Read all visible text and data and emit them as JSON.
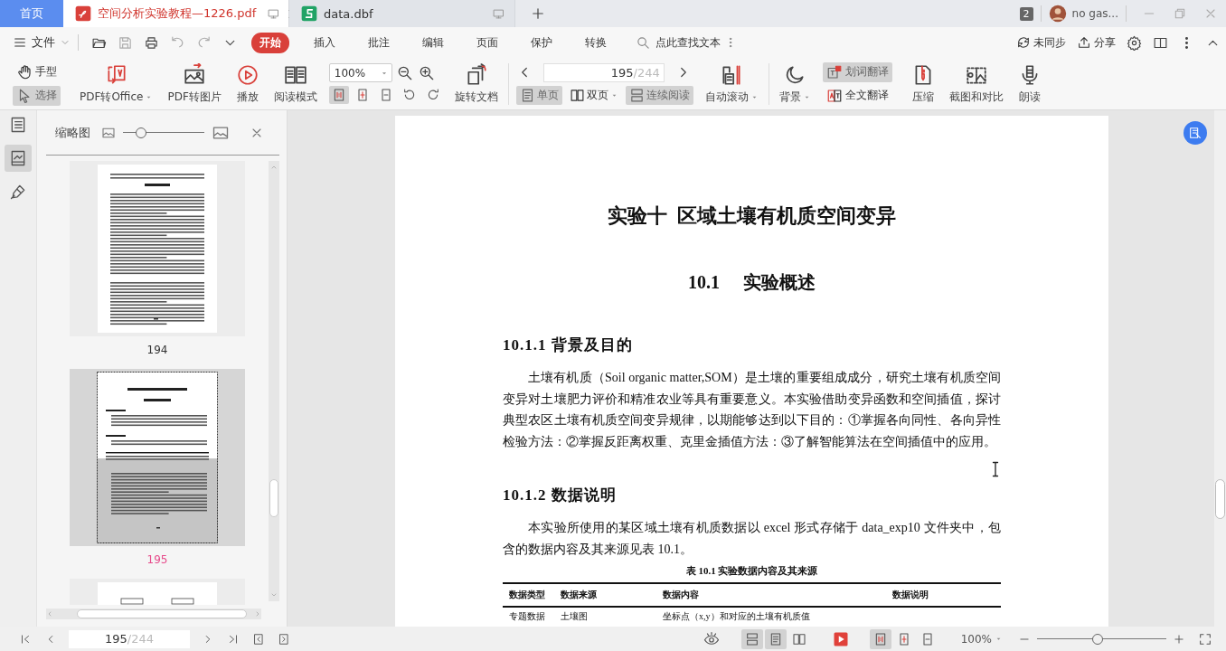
{
  "tabs": [
    {
      "label": "首页",
      "kind": "home",
      "selected": false
    },
    {
      "label": "空间分析实验教程—1226.pdf",
      "kind": "pdf",
      "selected": true
    },
    {
      "label": "data.dbf",
      "kind": "sheet",
      "selected": false
    }
  ],
  "window_count": "2",
  "user": {
    "name": "no gas..."
  },
  "menu": {
    "file": "文件",
    "items": [
      {
        "label": "开始",
        "selected": true
      },
      {
        "label": "插入",
        "selected": false
      },
      {
        "label": "批注",
        "selected": false
      },
      {
        "label": "编辑",
        "selected": false
      },
      {
        "label": "页面",
        "selected": false
      },
      {
        "label": "保护",
        "selected": false
      },
      {
        "label": "转换",
        "selected": false
      }
    ],
    "search": {
      "placeholder": "点此查找文本"
    },
    "sync": "未同步",
    "share": "分享"
  },
  "toolbar": {
    "groups": [
      [
        {
          "kind": "pair",
          "items": [
            {
              "label": "手型",
              "selected": false
            },
            {
              "label": "选择",
              "selected": true
            }
          ]
        },
        {
          "kind": "big",
          "label": "PDF转Office",
          "dropdown": true
        },
        {
          "kind": "big",
          "label": "PDF转图片",
          "dropdown": false
        },
        {
          "kind": "big",
          "label": "播放",
          "dropdown": false
        },
        {
          "kind": "big",
          "label": "阅读模式",
          "dropdown": false
        },
        {
          "kind": "zoom",
          "value": "100%",
          "view_buttons": [
            {
              "selected": true
            },
            {
              "selected": false
            },
            {
              "selected": false
            },
            {
              "selected": false
            },
            {
              "selected": false
            }
          ]
        },
        {
          "kind": "big",
          "label": "旋转文档",
          "dropdown": false
        }
      ],
      [
        {
          "kind": "pager",
          "value": "195",
          "total": "/244",
          "modes": [
            {
              "label": "单页",
              "selected": true,
              "dropdown": false
            },
            {
              "label": "双页",
              "selected": false,
              "dropdown": true
            },
            {
              "label": "连续阅读",
              "selected": true,
              "dropdown": false
            }
          ]
        },
        {
          "kind": "big",
          "label": "自动滚动",
          "dropdown": true
        }
      ],
      [
        {
          "kind": "big",
          "label": "背景",
          "dropdown": true
        },
        {
          "kind": "pair",
          "items": [
            {
              "label": "划词翻译",
              "selected": true
            },
            {
              "label": "全文翻译",
              "selected": false
            }
          ]
        },
        {
          "kind": "big",
          "label": "压缩",
          "dropdown": false
        },
        {
          "kind": "big",
          "label": "截图和对比",
          "dropdown": false
        },
        {
          "kind": "big",
          "label": "朗读",
          "dropdown": false
        }
      ]
    ]
  },
  "sidebar": {
    "title": "缩略图",
    "slider": {
      "level": 0.22
    },
    "thumbnails": [
      {
        "kind": "text",
        "page": "194",
        "selected": false
      },
      {
        "kind": "chapter",
        "page": "195",
        "selected": true
      },
      {
        "kind": "diagram",
        "selected": false
      }
    ]
  },
  "document": {
    "chapter_title": "实验十  区域土壤有机质空间变异",
    "section": {
      "number": "10.1",
      "title": "实验概述"
    },
    "blocks": [
      {
        "kind": "heading",
        "text": "10.1.1 背景及目的"
      },
      {
        "kind": "paragraph",
        "text": "土壤有机质（Soil organic matter,SOM）是土壤的重要组成成分，研究土壤有机质空间变异对土壤肥力评价和精准农业等具有重要意义。本实验借助变异函数和空间插值，探讨典型农区土壤有机质空间变异规律，以期能够达到以下目的：①掌握各向同性、各向异性检验方法：②掌握反距离权重、克里金插值方法：③了解智能算法在空间插值中的应用。"
      },
      {
        "kind": "heading",
        "text": "10.1.2 数据说明"
      },
      {
        "kind": "paragraph",
        "text": "本实验所使用的某区域土壤有机质数据以 excel 形式存储于 data_exp10 文件夹中，包含的数据内容及其来源见表 10.1。"
      },
      {
        "kind": "caption",
        "text": "表 10.1  实验数据内容及其来源"
      },
      {
        "kind": "table",
        "columns": [
          "数据类型",
          "数据来源",
          "数据内容",
          "数据说明"
        ],
        "rows": [
          [
            "专题数据",
            "土壤图",
            "坐标点（x,y）和对应的土壤有机质值"
          ]
        ]
      }
    ]
  },
  "status_bar": {
    "page": "195",
    "total": "/244",
    "layout_buttons": [
      {
        "selected": true
      },
      {
        "selected": true
      },
      {
        "selected": false
      }
    ],
    "fit_buttons": [
      {
        "selected": true
      },
      {
        "selected": false
      },
      {
        "selected": false
      }
    ],
    "zoom": "100%",
    "zoom_slider": {
      "level": 0.47
    }
  }
}
